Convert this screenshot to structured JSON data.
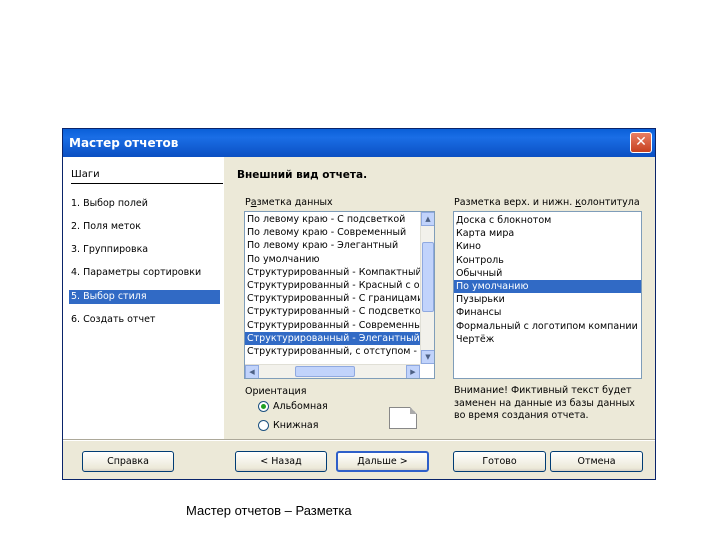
{
  "window": {
    "title": "Мастер отчетов",
    "close_glyph": "✕"
  },
  "steps": {
    "title": "Шаги",
    "items": [
      "1. Выбор полей",
      "2. Поля меток",
      "3. Группировка",
      "4. Параметры сортировки",
      "5. Выбор стиля",
      "6. Создать отчет"
    ],
    "selected_index": 4
  },
  "main": {
    "heading": "Внешний вид отчета.",
    "data_layout": {
      "label_prefix": "Р",
      "label_underlined": "а",
      "label_rest": "зметка данных",
      "items": [
        "По левому краю - С подсветкой",
        "По левому краю - Современный",
        "По левому краю - Элегантный",
        "По умолчанию",
        "Структурированный - Компактный",
        "Структурированный - Красный с о",
        "Структурированный - С границами",
        "Структурированный - С подсветкой",
        "Структурированный - Современный",
        "Структурированный - Элегантный",
        "Структурированный, с отступом -"
      ],
      "selected_index": 9
    },
    "header_footer_layout": {
      "label_prefix": "Разметка верх. и нижн. ",
      "label_underlined": "к",
      "label_rest": "олонтитула",
      "items": [
        "Доска с блокнотом",
        "Карта мира",
        "Кино",
        "Контроль",
        "Обычный",
        "По умолчанию",
        "Пузырьки",
        "Финансы",
        "Формальный с логотипом компании",
        "Чертёж"
      ],
      "selected_index": 5
    },
    "orientation": {
      "label": "Ориентация",
      "options": [
        {
          "label": "Альбомная",
          "checked": true
        },
        {
          "label": "Книжная",
          "checked": false
        }
      ]
    },
    "note": "Внимание! Фиктивный текст будет заменен на данные из базы данных во время создания отчета."
  },
  "buttons": {
    "help": "Справка",
    "back": "< Назад",
    "next": "Дальше >",
    "finish": "Готово",
    "cancel": "Отмена"
  },
  "caption": "Мастер отчетов – Разметка"
}
